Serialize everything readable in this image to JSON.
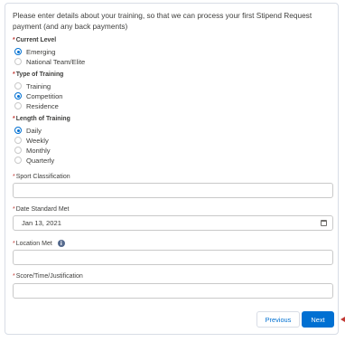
{
  "intro": "Please enter details about your training, so that we can process your first Stipend Request payment (and any back payments)",
  "required_mark": "*",
  "current_level": {
    "label": "Current Level",
    "options": [
      "Emerging",
      "National Team/Elite"
    ],
    "selected": "Emerging"
  },
  "type_of_training": {
    "label": "Type of Training",
    "options": [
      "Training",
      "Competition",
      "Residence"
    ],
    "selected": "Competition"
  },
  "length_of_training": {
    "label": "Length of Training",
    "options": [
      "Daily",
      "Weekly",
      "Monthly",
      "Quarterly"
    ],
    "selected": "Daily"
  },
  "sport_classification": {
    "label": "Sport Classification",
    "value": ""
  },
  "date_standard_met": {
    "label": "Date Standard Met",
    "value": "Jan 13, 2021",
    "icon": "calendar-icon"
  },
  "location_met": {
    "label": "Location Met",
    "value": "",
    "icon": "info-icon"
  },
  "score": {
    "label": "Score/Time/Justification",
    "value": ""
  },
  "buttons": {
    "previous": "Previous",
    "next": "Next"
  },
  "colors": {
    "accent": "#0070d2",
    "required": "#c23934",
    "border": "#c9c9c9"
  }
}
